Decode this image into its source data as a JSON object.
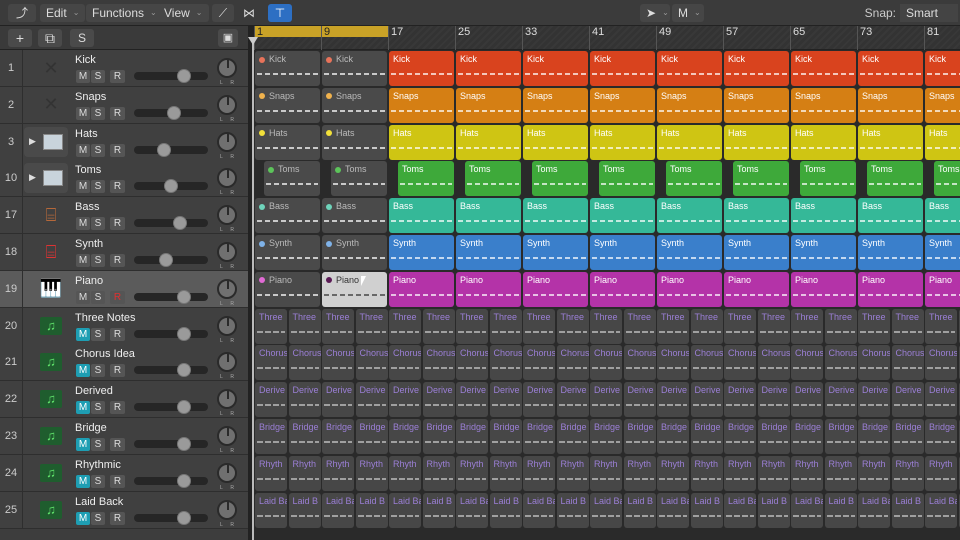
{
  "toolbar": {
    "back_icon": "back-arrow-icon",
    "edit": "Edit",
    "functions": "Functions",
    "view": "View",
    "automation_icon": "automation-curve-icon",
    "flex_icon": "flex-bowtie-icon",
    "catch_icon": "catch-playhead-icon",
    "pointer_tool": "pointer",
    "secondary_tool": "M",
    "snap_label": "Snap:",
    "snap_value": "Smart"
  },
  "header_tools": {
    "add": "+",
    "duplicate_icon": "duplicate-track-icon",
    "solo": "S",
    "library_icon": "library-icon"
  },
  "ruler": {
    "bars": [
      "1",
      "9",
      "17",
      "25",
      "33",
      "41",
      "49",
      "57",
      "65",
      "73",
      "81"
    ],
    "cycle": "1-17"
  },
  "tracks": [
    {
      "num": "1",
      "name": "Kick",
      "icon": "drum-stand-icon",
      "expand": false,
      "m": false,
      "r_armed": false,
      "fader": 0.72,
      "selected": false
    },
    {
      "num": "2",
      "name": "Snaps",
      "icon": "drum-stand-icon",
      "expand": false,
      "m": false,
      "r_armed": false,
      "fader": 0.55,
      "selected": false
    },
    {
      "num": "3",
      "name": "Hats",
      "icon": "drum-machine-icon",
      "expand": true,
      "m": false,
      "r_armed": false,
      "fader": 0.38,
      "selected": false
    },
    {
      "num": "10",
      "name": "Toms",
      "icon": "drum-machine-icon",
      "expand": true,
      "m": false,
      "r_armed": false,
      "fader": 0.5,
      "selected": false
    },
    {
      "num": "17",
      "name": "Bass",
      "icon": "keyboard-stand-icon",
      "expand": false,
      "m": false,
      "r_armed": false,
      "fader": 0.65,
      "selected": false
    },
    {
      "num": "18",
      "name": "Synth",
      "icon": "synth-keyboard-icon",
      "expand": false,
      "m": false,
      "r_armed": false,
      "fader": 0.42,
      "selected": false
    },
    {
      "num": "19",
      "name": "Piano",
      "icon": "grand-piano-icon",
      "expand": false,
      "m": false,
      "r_armed": true,
      "fader": 0.72,
      "selected": true
    },
    {
      "num": "20",
      "name": "Three Notes",
      "icon": "midi-note-icon",
      "expand": false,
      "m": true,
      "r_armed": false,
      "fader": 0.72,
      "selected": false
    },
    {
      "num": "21",
      "name": "Chorus Idea",
      "icon": "midi-note-icon",
      "expand": false,
      "m": true,
      "r_armed": false,
      "fader": 0.72,
      "selected": false
    },
    {
      "num": "22",
      "name": "Derived",
      "icon": "midi-note-icon",
      "expand": false,
      "m": true,
      "r_armed": false,
      "fader": 0.72,
      "selected": false
    },
    {
      "num": "23",
      "name": "Bridge",
      "icon": "midi-note-icon",
      "expand": false,
      "m": true,
      "r_armed": false,
      "fader": 0.72,
      "selected": false
    },
    {
      "num": "24",
      "name": "Rhythmic",
      "icon": "midi-note-icon",
      "expand": false,
      "m": true,
      "r_armed": false,
      "fader": 0.72,
      "selected": false
    },
    {
      "num": "25",
      "name": "Laid Back",
      "icon": "midi-note-icon",
      "expand": false,
      "m": true,
      "r_armed": false,
      "fader": 0.72,
      "selected": false
    }
  ],
  "msr_labels": {
    "m": "M",
    "s": "S",
    "r": "R",
    "pan_l": "L",
    "pan_r": "R"
  },
  "lanes": [
    {
      "label": "Kick",
      "color": "#d9431e",
      "dot": "#e8735a",
      "type": "drum"
    },
    {
      "label": "Snaps",
      "color": "#d57f14",
      "dot": "#f0b24d",
      "type": "drum"
    },
    {
      "label": "Hats",
      "color": "#cfc513",
      "dot": "#f2e03a",
      "type": "drum"
    },
    {
      "label": "Toms",
      "color": "#3ea93a",
      "dot": "#5cc45a",
      "type": "toms"
    },
    {
      "label": "Bass",
      "color": "#35b898",
      "dot": "#6fd4bb",
      "type": "drum"
    },
    {
      "label": "Synth",
      "color": "#3a7fcb",
      "dot": "#7fb2e8",
      "type": "drum"
    },
    {
      "label": "Piano",
      "color": "#b433a8",
      "dot": "#e06ad4",
      "type": "piano"
    },
    {
      "label": "Three",
      "type": "loop"
    },
    {
      "label": "Chorus",
      "type": "loop"
    },
    {
      "label": "Derive",
      "type": "loop"
    },
    {
      "label": "Bridge",
      "type": "loop"
    },
    {
      "label": "Rhyth",
      "type": "loop"
    },
    {
      "label": "Laid Ba",
      "alt": "Laid B",
      "type": "loop"
    }
  ]
}
